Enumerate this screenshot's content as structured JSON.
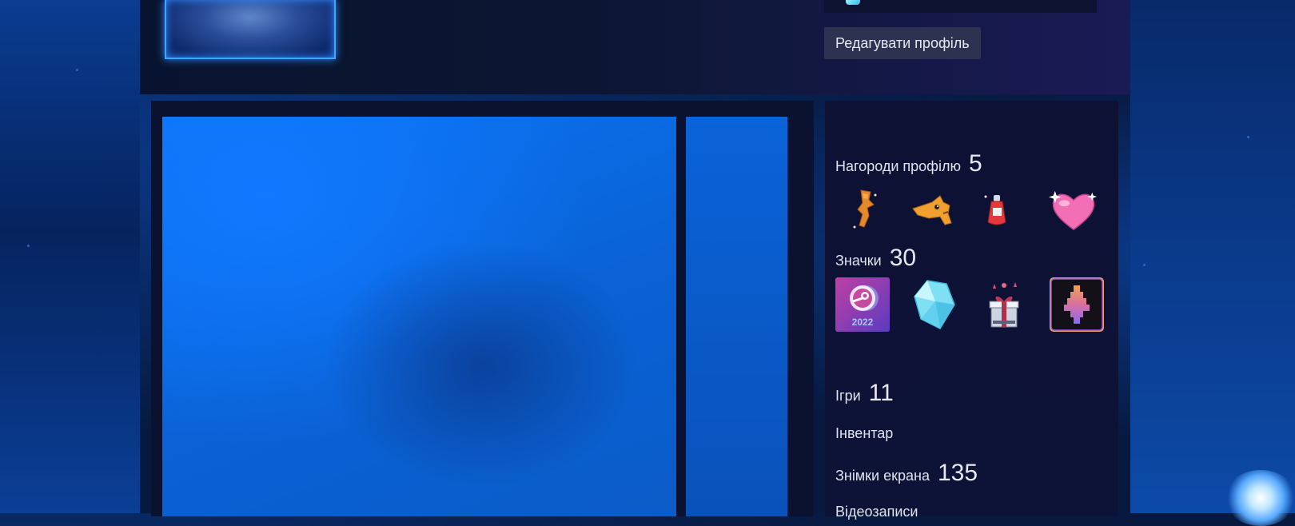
{
  "header": {
    "edit_profile_label": "Редагувати профіль"
  },
  "sidebar": {
    "awards": {
      "label": "Нагороди профілю",
      "count": "5"
    },
    "badges": {
      "label": "Значки",
      "count": "30",
      "year_badge_text": "2022"
    },
    "games": {
      "label": "Ігри",
      "count": "11"
    },
    "inventory": {
      "label": "Інвентар"
    },
    "screenshots": {
      "label": "Знімки екрана",
      "count": "135"
    },
    "videos": {
      "label": "Відеозаписи"
    }
  },
  "award_icons": [
    "orange-figure-icon",
    "orange-cat-icon",
    "red-bottle-icon",
    "pink-heart-icon"
  ],
  "badge_icons": [
    "steam-2022-badge-icon",
    "blue-crystal-badge-icon",
    "gift-box-badge-icon",
    "pixel-tree-badge-icon"
  ],
  "colors": {
    "showcase_blue": "#0a6ae0",
    "frame_glow": "#3fa6ff",
    "panel_bg": "#0d1234",
    "button_bg": "#2c3250",
    "heart_pink": "#f26fb5"
  }
}
